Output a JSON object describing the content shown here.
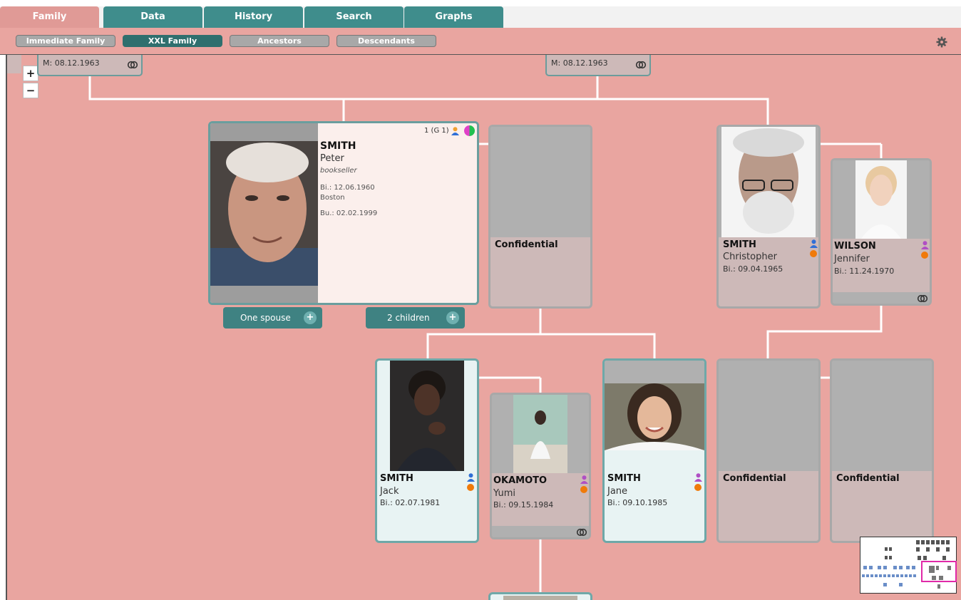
{
  "tabs": [
    {
      "label": "Family",
      "active": true
    },
    {
      "label": "Data",
      "active": false
    },
    {
      "label": "History",
      "active": false
    },
    {
      "label": "Search",
      "active": false
    },
    {
      "label": "Graphs",
      "active": false
    }
  ],
  "subtabs": [
    {
      "label": "Immediate Family",
      "active": false
    },
    {
      "label": "XXL Family",
      "active": true
    },
    {
      "label": "Ancestors",
      "active": false
    },
    {
      "label": "Descendants",
      "active": false
    }
  ],
  "zoom": {
    "in": "+",
    "out": "−"
  },
  "marriages": [
    {
      "text": "M: 08.12.1963"
    },
    {
      "text": "M: 08.12.1963"
    }
  ],
  "focus": {
    "counter": "1 (G 1)",
    "surname": "SMITH",
    "given": "Peter",
    "occupation": "bookseller",
    "birth": "Bi.: 12.06.1960",
    "birthplace": "Boston",
    "burial": "Bu.: 02.02.1999"
  },
  "pills": {
    "spouses": "One spouse",
    "children": "2 children",
    "plus": "+"
  },
  "confidential_label": "Confidential",
  "people": {
    "christopher": {
      "surname": "SMITH",
      "given": "Christopher",
      "birth": "Bi.: 09.04.1965"
    },
    "jennifer": {
      "surname": "WILSON",
      "given": "Jennifer",
      "birth": "Bi.: 11.24.1970"
    },
    "jack": {
      "surname": "SMITH",
      "given": "Jack",
      "birth": "Bi.: 02.07.1981"
    },
    "yumi": {
      "surname": "OKAMOTO",
      "given": "Yumi",
      "birth": "Bi.: 09.15.1984"
    },
    "jane": {
      "surname": "SMITH",
      "given": "Jane",
      "birth": "Bi.: 09.10.1985"
    }
  },
  "colors": {
    "male": "#2f6fd6",
    "female": "#b04fc4",
    "accent": "#3f8d8c",
    "background": "#e9a5a0"
  },
  "icons": [
    "gear-icon",
    "link-icon",
    "male-icon",
    "female-icon",
    "half-circle-icon",
    "plus-icon"
  ]
}
